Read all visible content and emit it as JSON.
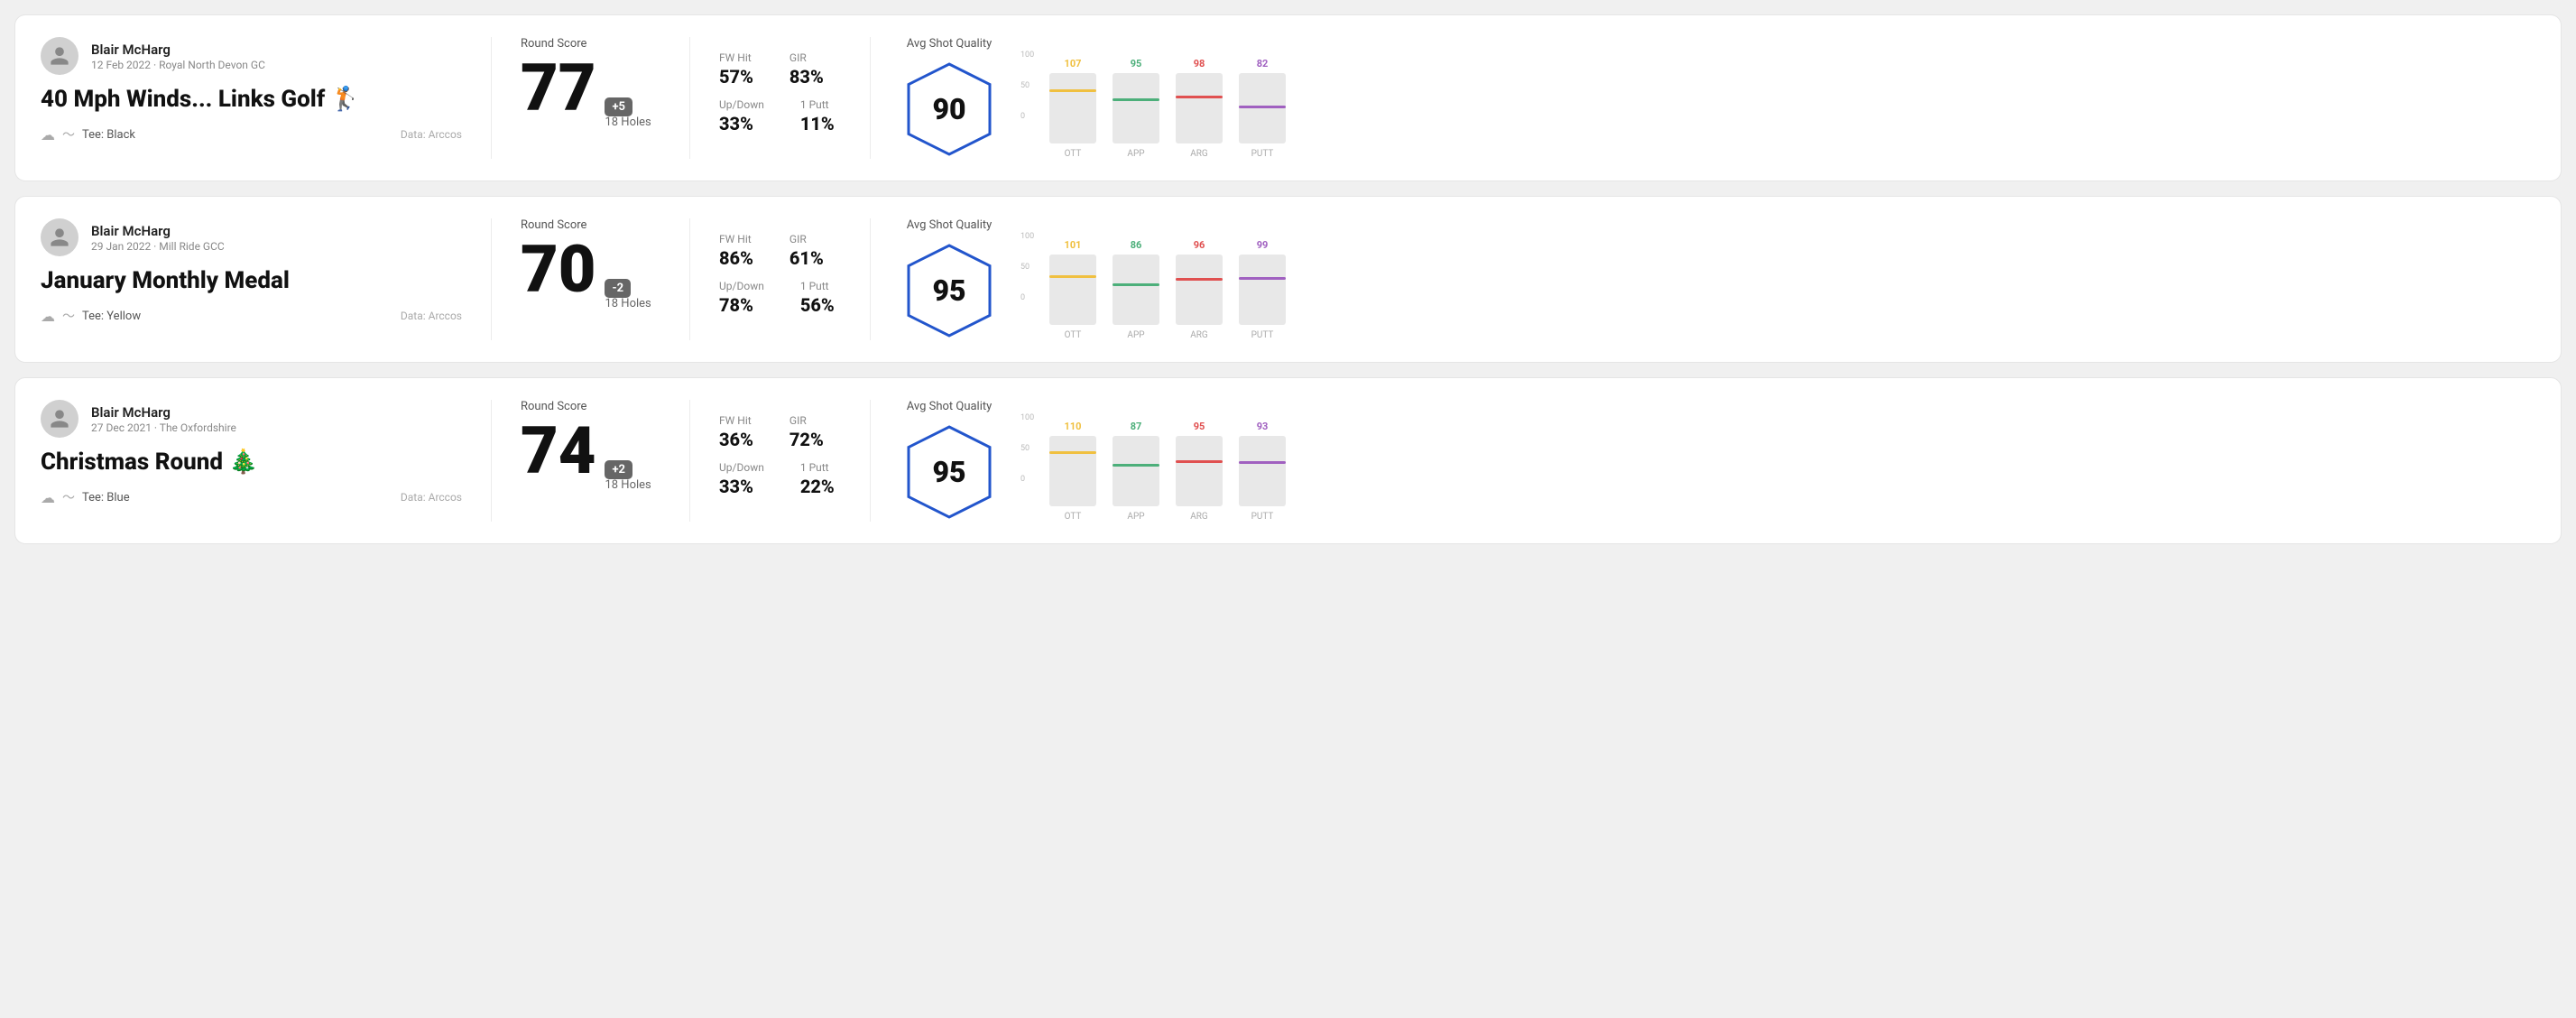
{
  "cards": [
    {
      "id": "card1",
      "user": {
        "name": "Blair McHarg",
        "date": "12 Feb 2022 · Royal North Devon GC"
      },
      "title": "40 Mph Winds... Links Golf",
      "emoji": "🏌️",
      "tee": "Black",
      "data_source": "Data: Arccos",
      "score": {
        "label": "Round Score",
        "number": "77",
        "badge": "+5",
        "badge_type": "over",
        "holes": "18 Holes"
      },
      "stats": [
        {
          "label": "FW Hit",
          "value": "57%"
        },
        {
          "label": "GIR",
          "value": "83%"
        },
        {
          "label": "Up/Down",
          "value": "33%"
        },
        {
          "label": "1 Putt",
          "value": "11%"
        }
      ],
      "quality": {
        "label": "Avg Shot Quality",
        "score": "90"
      },
      "chart": {
        "bars": [
          {
            "label": "OTT",
            "value": 107,
            "color": "#f0c040",
            "pct": 72
          },
          {
            "label": "APP",
            "value": 95,
            "color": "#4caf7a",
            "pct": 60
          },
          {
            "label": "ARG",
            "value": 98,
            "color": "#e05050",
            "pct": 63
          },
          {
            "label": "PUTT",
            "value": 82,
            "color": "#a060c0",
            "pct": 50
          }
        ]
      }
    },
    {
      "id": "card2",
      "user": {
        "name": "Blair McHarg",
        "date": "29 Jan 2022 · Mill Ride GCC"
      },
      "title": "January Monthly Medal",
      "emoji": "",
      "tee": "Yellow",
      "data_source": "Data: Arccos",
      "score": {
        "label": "Round Score",
        "number": "70",
        "badge": "-2",
        "badge_type": "under",
        "holes": "18 Holes"
      },
      "stats": [
        {
          "label": "FW Hit",
          "value": "86%"
        },
        {
          "label": "GIR",
          "value": "61%"
        },
        {
          "label": "Up/Down",
          "value": "78%"
        },
        {
          "label": "1 Putt",
          "value": "56%"
        }
      ],
      "quality": {
        "label": "Avg Shot Quality",
        "score": "95"
      },
      "chart": {
        "bars": [
          {
            "label": "OTT",
            "value": 101,
            "color": "#f0c040",
            "pct": 66
          },
          {
            "label": "APP",
            "value": 86,
            "color": "#4caf7a",
            "pct": 55
          },
          {
            "label": "ARG",
            "value": 96,
            "color": "#e05050",
            "pct": 62
          },
          {
            "label": "PUTT",
            "value": 99,
            "color": "#a060c0",
            "pct": 64
          }
        ]
      }
    },
    {
      "id": "card3",
      "user": {
        "name": "Blair McHarg",
        "date": "27 Dec 2021 · The Oxfordshire"
      },
      "title": "Christmas Round",
      "emoji": "🎄",
      "tee": "Blue",
      "data_source": "Data: Arccos",
      "score": {
        "label": "Round Score",
        "number": "74",
        "badge": "+2",
        "badge_type": "over",
        "holes": "18 Holes"
      },
      "stats": [
        {
          "label": "FW Hit",
          "value": "36%"
        },
        {
          "label": "GIR",
          "value": "72%"
        },
        {
          "label": "Up/Down",
          "value": "33%"
        },
        {
          "label": "1 Putt",
          "value": "22%"
        }
      ],
      "quality": {
        "label": "Avg Shot Quality",
        "score": "95"
      },
      "chart": {
        "bars": [
          {
            "label": "OTT",
            "value": 110,
            "color": "#f0c040",
            "pct": 74
          },
          {
            "label": "APP",
            "value": 87,
            "color": "#4caf7a",
            "pct": 56
          },
          {
            "label": "ARG",
            "value": 95,
            "color": "#e05050",
            "pct": 61
          },
          {
            "label": "PUTT",
            "value": 93,
            "color": "#a060c0",
            "pct": 60
          }
        ]
      }
    }
  ],
  "y_axis": [
    "100",
    "50",
    "0"
  ]
}
